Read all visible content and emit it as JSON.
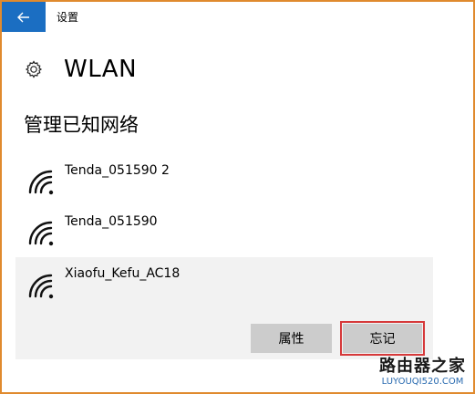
{
  "window": {
    "title": "设置"
  },
  "header": {
    "icon": "gear-icon",
    "title": "WLAN"
  },
  "section": {
    "title": "管理已知网络"
  },
  "networks": [
    {
      "name": "Tenda_051590 2",
      "icon": "wifi-icon"
    },
    {
      "name": "Tenda_051590",
      "icon": "wifi-icon"
    },
    {
      "name": "Xiaofu_Kefu_AC18",
      "icon": "wifi-icon",
      "selected": true
    }
  ],
  "actions": {
    "properties_label": "属性",
    "forget_label": "忘记"
  },
  "watermark": {
    "text": "路由器之家",
    "url": "LUYOUQI520.COM"
  },
  "colors": {
    "accent": "#1b6ec2",
    "highlight_border": "#d6393a",
    "frame_border": "#e08a2e",
    "selected_bg": "#f2f2f2",
    "button_bg": "#cccccc"
  }
}
